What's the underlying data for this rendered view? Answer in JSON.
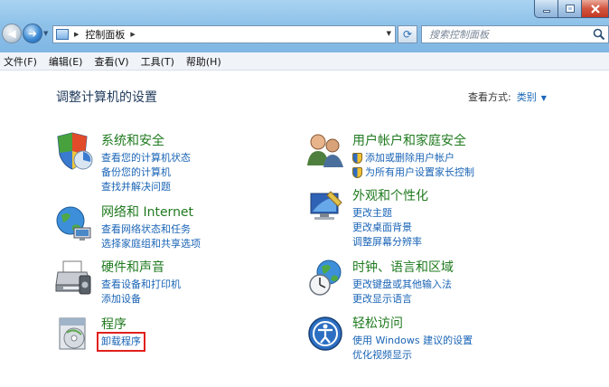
{
  "window": {
    "address_crumb": "控制面板",
    "search_placeholder": "搜索控制面板"
  },
  "menu": [
    "文件(F)",
    "编辑(E)",
    "查看(V)",
    "工具(T)",
    "帮助(H)"
  ],
  "main": {
    "title": "调整计算机的设置",
    "view_by_label": "查看方式:",
    "view_by_value": "类别"
  },
  "categories": [
    {
      "title": "系统和安全",
      "icon": "shield-chart-icon",
      "links": [
        {
          "text": "查看您的计算机状态"
        },
        {
          "text": "备份您的计算机"
        },
        {
          "text": "查找并解决问题"
        }
      ]
    },
    {
      "title": "网络和 Internet",
      "icon": "network-globe-icon",
      "links": [
        {
          "text": "查看网络状态和任务"
        },
        {
          "text": "选择家庭组和共享选项"
        }
      ]
    },
    {
      "title": "硬件和声音",
      "icon": "printer-icon",
      "links": [
        {
          "text": "查看设备和打印机"
        },
        {
          "text": "添加设备"
        }
      ]
    },
    {
      "title": "程序",
      "icon": "programs-icon",
      "links": [
        {
          "text": "卸载程序",
          "highlighted": true
        }
      ]
    },
    {
      "title": "用户帐户和家庭安全",
      "icon": "users-icon",
      "links": [
        {
          "text": "添加或删除用户帐户",
          "shield": true
        },
        {
          "text": "为所有用户设置家长控制",
          "shield": true
        }
      ]
    },
    {
      "title": "外观和个性化",
      "icon": "display-icon",
      "links": [
        {
          "text": "更改主题"
        },
        {
          "text": "更改桌面背景"
        },
        {
          "text": "调整屏幕分辨率"
        }
      ]
    },
    {
      "title": "时钟、语言和区域",
      "icon": "clock-globe-icon",
      "links": [
        {
          "text": "更改键盘或其他输入法"
        },
        {
          "text": "更改显示语言"
        }
      ]
    },
    {
      "title": "轻松访问",
      "icon": "ease-of-access-icon",
      "links": [
        {
          "text": "使用 Windows 建议的设置"
        },
        {
          "text": "优化视频显示"
        }
      ]
    }
  ],
  "colors": {
    "title_green": "#1f7a1f",
    "link_blue": "#1a64b6",
    "highlight_red": "#e0211e"
  }
}
